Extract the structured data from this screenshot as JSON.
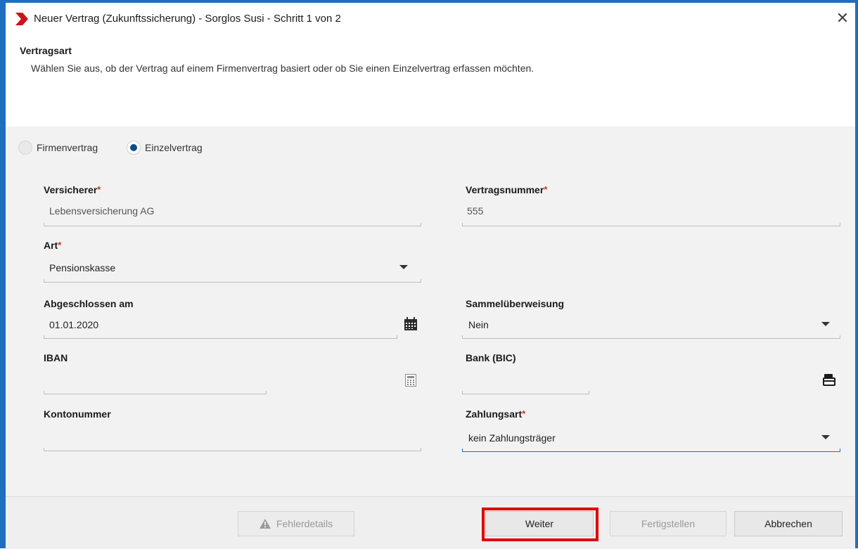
{
  "window": {
    "title": "Neuer Vertrag (Zukunftssicherung) - Sorglos Susi - Schritt 1 von 2",
    "close_label": "✕"
  },
  "header": {
    "section_title": "Vertragsart",
    "description": "Wählen Sie aus, ob der Vertrag auf einem Firmenvertrag basiert oder ob Sie einen Einzelvertrag erfassen möchten."
  },
  "contract_type": {
    "options": [
      {
        "label": "Firmenvertrag",
        "selected": false
      },
      {
        "label": "Einzelvertrag",
        "selected": true
      }
    ]
  },
  "fields": {
    "versicherer": {
      "label": "Versicherer",
      "required_mark": "*",
      "value": "Lebensversicherung AG"
    },
    "vertragsnummer": {
      "label": "Vertragsnummer",
      "required_mark": "*",
      "value": "555"
    },
    "art": {
      "label": "Art",
      "required_mark": "*",
      "value": "Pensionskasse"
    },
    "abgeschlossen_am": {
      "label": "Abgeschlossen am",
      "value": "01.01.2020"
    },
    "sammelueberweisung": {
      "label": "Sammelüberweisung",
      "value": "Nein"
    },
    "iban": {
      "label": "IBAN",
      "value": ""
    },
    "bic": {
      "label": "Bank (BIC)",
      "value": ""
    },
    "kontonummer": {
      "label": "Kontonummer",
      "value": ""
    },
    "zahlungsart": {
      "label": "Zahlungsart",
      "required_mark": "*",
      "value": "kein Zahlungsträger"
    }
  },
  "footer": {
    "error_details_label": "Fehlerdetails",
    "next_label": "Weiter",
    "finish_label": "Fertigstellen",
    "cancel_label": "Abbrechen"
  },
  "colors": {
    "window_border": "#1e6fbf",
    "accent": "#0d4c8c",
    "required": "#d0312d",
    "highlight": "#e00000"
  }
}
